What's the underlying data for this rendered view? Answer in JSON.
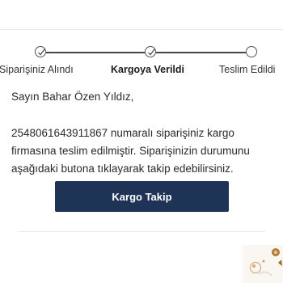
{
  "stepper": {
    "steps": [
      {
        "label": "Siparişiniz Alındı",
        "status": "done"
      },
      {
        "label": "Kargoya Verildi",
        "status": "current"
      },
      {
        "label": "Teslim Edildi",
        "status": "pending"
      }
    ]
  },
  "content": {
    "greeting": "Sayın Bahar Özen Yıldız,",
    "line1": "2548061643911867 numaralı siparişiniz kargo",
    "line2": "firmasına teslim edilmiştir. Siparişinizin durumunu",
    "line3": "aşağıdaki butona tıklayarak takip edebilirsiniz."
  },
  "button": {
    "label": "Kargo Takip"
  },
  "colors": {
    "button_bg": "#1f3357",
    "button_text": "#ffffff",
    "text": "#2a2a2a",
    "divider": "#ececec"
  },
  "icons": {
    "completed_step": "check-circle-icon",
    "pending_step": "empty-circle-icon",
    "decor": "product-thumbnail"
  }
}
